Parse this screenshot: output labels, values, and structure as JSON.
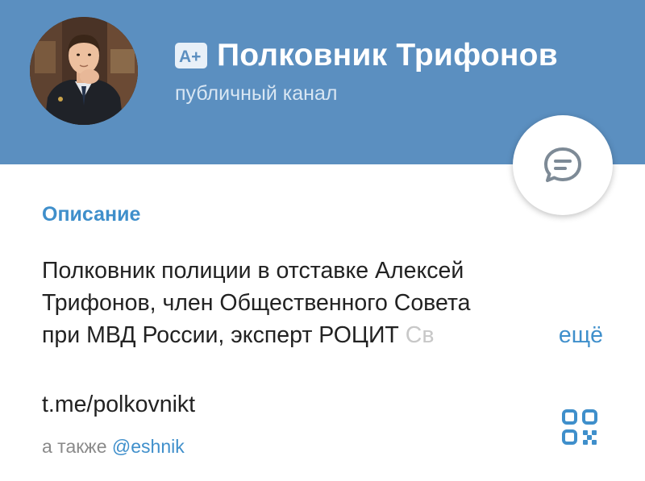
{
  "channel": {
    "name": "Полковник Трифонов",
    "type_label": "публичный канал",
    "badge_text": "A+"
  },
  "description": {
    "label": "Описание",
    "lines": [
      "Полковник полиции в отставке Алексей",
      "Трифонов, член Общественного Совета",
      "при МВД России, эксперт РОЦИТ"
    ],
    "faded_text": "Св",
    "more_label": "ещё"
  },
  "link": {
    "url": "t.me/polkovnikt",
    "also_prefix": "а также",
    "also_handle": "@eshnik"
  },
  "colors": {
    "header_bg": "#5b8fc0",
    "accent": "#3f8fcb",
    "text": "#222222",
    "muted": "#8a8a8a"
  },
  "icons": {
    "message": "chat-bubble-icon",
    "qr": "qr-code-icon",
    "avatar": "channel-avatar"
  }
}
